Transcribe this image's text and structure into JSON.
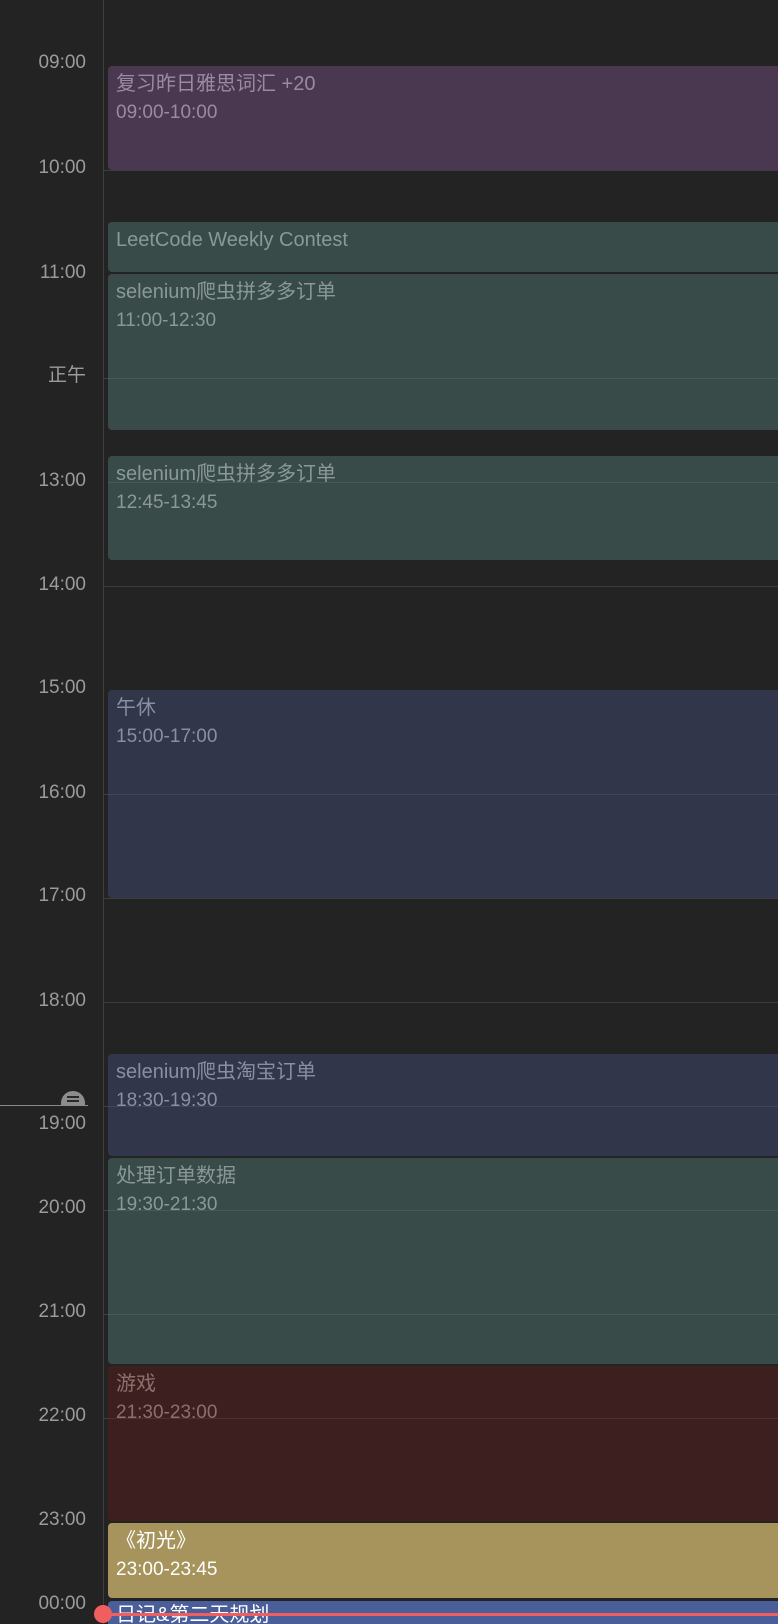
{
  "hours": [
    {
      "label": "09:00"
    },
    {
      "label": "10:00"
    },
    {
      "label": "11:00"
    },
    {
      "label": "正午"
    },
    {
      "label": "13:00"
    },
    {
      "label": "14:00"
    },
    {
      "label": "15:00"
    },
    {
      "label": "16:00"
    },
    {
      "label": "17:00"
    },
    {
      "label": "18:00"
    },
    {
      "label": "19:00"
    },
    {
      "label": "20:00"
    },
    {
      "label": "21:00"
    },
    {
      "label": "22:00"
    },
    {
      "label": "23:00"
    },
    {
      "label": "00:00"
    }
  ],
  "events": [
    {
      "title": "复习昨日雅思词汇 +20",
      "time": "09:00-10:00",
      "bg": "#4a3750",
      "fg": "#9b8aa3"
    },
    {
      "title": "LeetCode Weekly Contest",
      "time": "",
      "bg": "#384b49",
      "fg": "#8a9896"
    },
    {
      "title": "selenium爬虫拼多多订单",
      "time": "11:00-12:30",
      "bg": "#384b49",
      "fg": "#8a9896"
    },
    {
      "title": "selenium爬虫拼多多订单",
      "time": "12:45-13:45",
      "bg": "#384b49",
      "fg": "#8a9896"
    },
    {
      "title": "午休",
      "time": "15:00-17:00",
      "bg": "#31364a",
      "fg": "#8a8fa0"
    },
    {
      "title": "selenium爬虫淘宝订单",
      "time": "18:30-19:30",
      "bg": "#31364a",
      "fg": "#8a8fa0"
    },
    {
      "title": "处理订单数据",
      "time": "19:30-21:30",
      "bg": "#384b49",
      "fg": "#8a9896"
    },
    {
      "title": "游戏",
      "time": "21:30-23:00",
      "bg": "#3c1f1e",
      "fg": "#8f6f6d"
    },
    {
      "title": "《初光》",
      "time": "23:00-23:45",
      "bg": "#a6945c",
      "fg": "#ffffff"
    },
    {
      "title": "日记&第二天规划",
      "time": "",
      "bg": "#4a5e9a",
      "fg": "#ffffff"
    }
  ],
  "colors": {
    "current_time": "#f05e5e",
    "now_indicator": "#8d8d8d"
  },
  "icons": {
    "now_handle": "drag-handle-icon"
  }
}
